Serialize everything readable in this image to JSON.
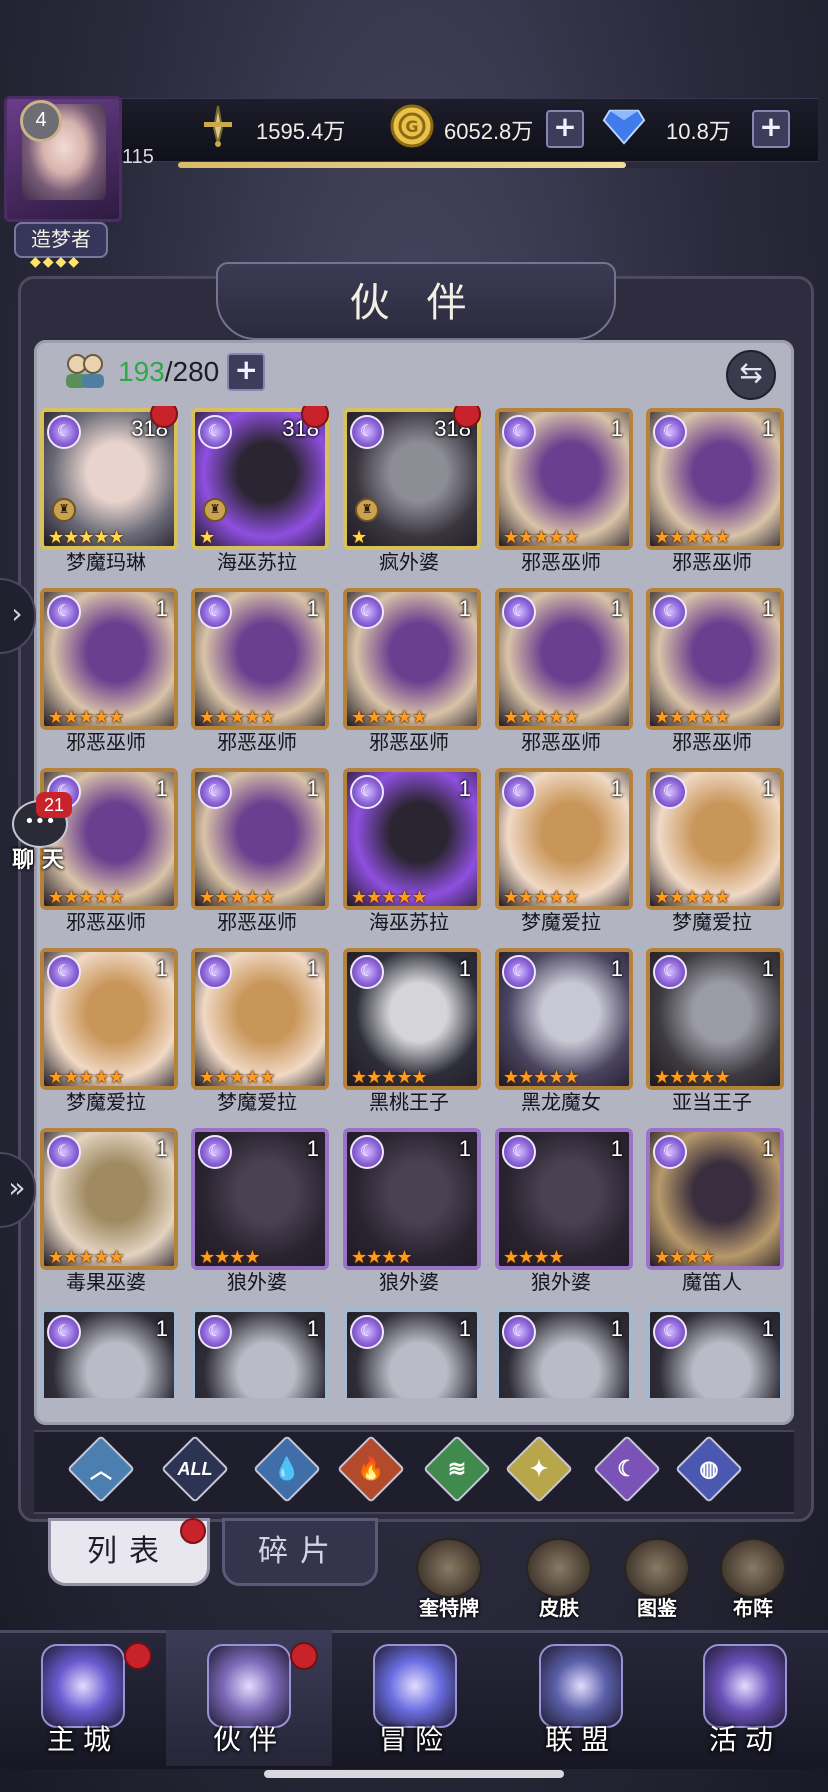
{
  "player": {
    "level": "4",
    "exp_value": "115",
    "exp_progress": 0.8,
    "title": "造梦者"
  },
  "resources": [
    {
      "icon": "sword-icon",
      "value": "1595.4万",
      "has_plus": false
    },
    {
      "icon": "gold-coin-icon",
      "value": "6052.8万",
      "has_plus": true
    },
    {
      "icon": "diamond-icon",
      "value": "10.8万",
      "has_plus": true
    }
  ],
  "page_title": "伙 伴",
  "roster": {
    "count": "193",
    "separator": "/",
    "capacity": "280"
  },
  "heroes": [
    {
      "name": "梦魔玛琳",
      "level": "318",
      "frame": "gold",
      "stars": 5,
      "star_color": "gold",
      "red_dot": true,
      "locked": true,
      "palette": [
        "#e8d4cc",
        "#6b6b78"
      ]
    },
    {
      "name": "海巫苏拉",
      "level": "318",
      "frame": "gold",
      "stars": 1,
      "star_color": "gold",
      "red_dot": true,
      "locked": true,
      "palette": [
        "#2a2530",
        "#8f4fe0"
      ]
    },
    {
      "name": "疯外婆",
      "level": "318",
      "frame": "gold",
      "stars": 1,
      "star_color": "gold",
      "red_dot": true,
      "locked": true,
      "palette": [
        "#8d8d96",
        "#3a3640"
      ]
    },
    {
      "name": "邪恶巫师",
      "level": "1",
      "frame": "bronze",
      "stars": 5,
      "star_color": "orange",
      "red_dot": false,
      "locked": false,
      "palette": [
        "#6a3f8f",
        "#d9c3a8"
      ]
    },
    {
      "name": "邪恶巫师",
      "level": "1",
      "frame": "bronze",
      "stars": 5,
      "star_color": "orange",
      "red_dot": false,
      "locked": false,
      "palette": [
        "#6a3f8f",
        "#d9c3a8"
      ]
    },
    {
      "name": "邪恶巫师",
      "level": "1",
      "frame": "bronze",
      "stars": 5,
      "star_color": "orange",
      "red_dot": false,
      "locked": false,
      "palette": [
        "#6a3f8f",
        "#d9c3a8"
      ]
    },
    {
      "name": "邪恶巫师",
      "level": "1",
      "frame": "bronze",
      "stars": 5,
      "star_color": "orange",
      "red_dot": false,
      "locked": false,
      "palette": [
        "#6a3f8f",
        "#d9c3a8"
      ]
    },
    {
      "name": "邪恶巫师",
      "level": "1",
      "frame": "bronze",
      "stars": 5,
      "star_color": "orange",
      "red_dot": false,
      "locked": false,
      "palette": [
        "#6a3f8f",
        "#d9c3a8"
      ]
    },
    {
      "name": "邪恶巫师",
      "level": "1",
      "frame": "bronze",
      "stars": 5,
      "star_color": "orange",
      "red_dot": false,
      "locked": false,
      "palette": [
        "#6a3f8f",
        "#d9c3a8"
      ]
    },
    {
      "name": "邪恶巫师",
      "level": "1",
      "frame": "bronze",
      "stars": 5,
      "star_color": "orange",
      "red_dot": false,
      "locked": false,
      "palette": [
        "#6a3f8f",
        "#d9c3a8"
      ]
    },
    {
      "name": "邪恶巫师",
      "level": "1",
      "frame": "bronze",
      "stars": 5,
      "star_color": "orange",
      "red_dot": false,
      "locked": false,
      "palette": [
        "#6a3f8f",
        "#d9c3a8"
      ]
    },
    {
      "name": "邪恶巫师",
      "level": "1",
      "frame": "bronze",
      "stars": 5,
      "star_color": "orange",
      "red_dot": false,
      "locked": false,
      "palette": [
        "#6a3f8f",
        "#d9c3a8"
      ]
    },
    {
      "name": "海巫苏拉",
      "level": "1",
      "frame": "bronze",
      "stars": 5,
      "star_color": "orange",
      "red_dot": false,
      "locked": false,
      "palette": [
        "#2a2530",
        "#8f4fe0"
      ]
    },
    {
      "name": "梦魔爱拉",
      "level": "1",
      "frame": "bronze",
      "stars": 5,
      "star_color": "orange",
      "red_dot": false,
      "locked": false,
      "palette": [
        "#c9965a",
        "#f0d9c5"
      ]
    },
    {
      "name": "梦魔爱拉",
      "level": "1",
      "frame": "bronze",
      "stars": 5,
      "star_color": "orange",
      "red_dot": false,
      "locked": false,
      "palette": [
        "#c9965a",
        "#f0d9c5"
      ]
    },
    {
      "name": "梦魔爱拉",
      "level": "1",
      "frame": "bronze",
      "stars": 5,
      "star_color": "orange",
      "red_dot": false,
      "locked": false,
      "palette": [
        "#c9965a",
        "#f0d9c5"
      ]
    },
    {
      "name": "梦魔爱拉",
      "level": "1",
      "frame": "bronze",
      "stars": 5,
      "star_color": "orange",
      "red_dot": false,
      "locked": false,
      "palette": [
        "#c9965a",
        "#f0d9c5"
      ]
    },
    {
      "name": "黑桃王子",
      "level": "1",
      "frame": "bronze",
      "stars": 5,
      "star_color": "orange",
      "red_dot": false,
      "locked": false,
      "palette": [
        "#d5d5d9",
        "#2e2e3a"
      ]
    },
    {
      "name": "黑龙魔女",
      "level": "1",
      "frame": "bronze",
      "stars": 5,
      "star_color": "orange",
      "red_dot": false,
      "locked": false,
      "palette": [
        "#c8c8d4",
        "#4a4460"
      ]
    },
    {
      "name": "亚当王子",
      "level": "1",
      "frame": "bronze",
      "stars": 5,
      "star_color": "orange",
      "red_dot": false,
      "locked": false,
      "palette": [
        "#9b9ba6",
        "#3d3b40"
      ]
    },
    {
      "name": "毒果巫婆",
      "level": "1",
      "frame": "bronze",
      "stars": 5,
      "star_color": "orange",
      "red_dot": false,
      "locked": false,
      "palette": [
        "#a08a62",
        "#e3d3c0"
      ]
    },
    {
      "name": "狼外婆",
      "level": "1",
      "frame": "purple",
      "stars": 4,
      "star_color": "orange",
      "red_dot": false,
      "locked": false,
      "palette": [
        "#4b4152",
        "#2a2430"
      ]
    },
    {
      "name": "狼外婆",
      "level": "1",
      "frame": "purple",
      "stars": 4,
      "star_color": "orange",
      "red_dot": false,
      "locked": false,
      "palette": [
        "#4b4152",
        "#2a2430"
      ]
    },
    {
      "name": "狼外婆",
      "level": "1",
      "frame": "purple",
      "stars": 4,
      "star_color": "orange",
      "red_dot": false,
      "locked": false,
      "palette": [
        "#4b4152",
        "#2a2430"
      ]
    },
    {
      "name": "魔笛人",
      "level": "1",
      "frame": "purple",
      "stars": 4,
      "star_color": "orange",
      "red_dot": false,
      "locked": false,
      "palette": [
        "#3a2e3e",
        "#b7996a"
      ]
    },
    {
      "name": "",
      "level": "1",
      "frame": "blue",
      "stars": 0,
      "star_color": "orange",
      "red_dot": false,
      "locked": false,
      "palette": [
        "#b9bcc6",
        "#2e2c36"
      ]
    },
    {
      "name": "",
      "level": "1",
      "frame": "blue",
      "stars": 0,
      "star_color": "orange",
      "red_dot": false,
      "locked": false,
      "palette": [
        "#b9bcc6",
        "#2e2c36"
      ]
    },
    {
      "name": "",
      "level": "1",
      "frame": "blue",
      "stars": 0,
      "star_color": "orange",
      "red_dot": false,
      "locked": false,
      "palette": [
        "#b9bcc6",
        "#2e2c36"
      ]
    },
    {
      "name": "",
      "level": "1",
      "frame": "blue",
      "stars": 0,
      "star_color": "orange",
      "red_dot": false,
      "locked": false,
      "palette": [
        "#b9bcc6",
        "#2e2c36"
      ]
    },
    {
      "name": "",
      "level": "1",
      "frame": "blue",
      "stars": 0,
      "star_color": "orange",
      "red_dot": false,
      "locked": false,
      "palette": [
        "#b9bcc6",
        "#2e2c36"
      ]
    }
  ],
  "filters": [
    {
      "id": "tier",
      "label": "",
      "icon": "chevron-up-icon",
      "color": "#4a7fb0"
    },
    {
      "id": "all",
      "label": "ALL",
      "icon": "all-icon",
      "color": "#2d3352"
    },
    {
      "id": "water",
      "label": "",
      "icon": "water-drop-icon",
      "color": "#3f6ea8"
    },
    {
      "id": "fire",
      "label": "",
      "icon": "fire-icon",
      "color": "#b34a2c"
    },
    {
      "id": "wind",
      "label": "",
      "icon": "wind-icon",
      "color": "#3f8a4c"
    },
    {
      "id": "light",
      "label": "",
      "icon": "light-star-icon",
      "color": "#b8a64a"
    },
    {
      "id": "dark",
      "label": "",
      "icon": "moon-icon",
      "color": "#7b52b6"
    },
    {
      "id": "cosmic",
      "label": "",
      "icon": "planet-icon",
      "color": "#4a58b0"
    }
  ],
  "subtabs": {
    "list": "列表",
    "fragments": "碎片"
  },
  "side_actions": [
    {
      "label": "奎特牌",
      "icon": "tarot-cards-icon"
    },
    {
      "label": "皮肤",
      "icon": "skin-icon"
    },
    {
      "label": "图鉴",
      "icon": "codex-icon"
    },
    {
      "label": "布阵",
      "icon": "formation-icon"
    }
  ],
  "chat": {
    "badge_count": "21",
    "label": "聊 天"
  },
  "bottom_nav": [
    {
      "label": "主城",
      "icon": "castle-icon",
      "red_dot": true,
      "active": false,
      "color": "#6b5ad0"
    },
    {
      "label": "伙伴",
      "icon": "witch-hat-icon",
      "red_dot": true,
      "active": true,
      "color": "#7d6ab8"
    },
    {
      "label": "冒险",
      "icon": "portal-icon",
      "red_dot": false,
      "active": false,
      "color": "#6a6de0"
    },
    {
      "label": "联盟",
      "icon": "shield-icon",
      "red_dot": false,
      "active": false,
      "color": "#5a5fa8"
    },
    {
      "label": "活动",
      "icon": "cards-icon",
      "red_dot": false,
      "active": false,
      "color": "#6a50b8"
    }
  ]
}
